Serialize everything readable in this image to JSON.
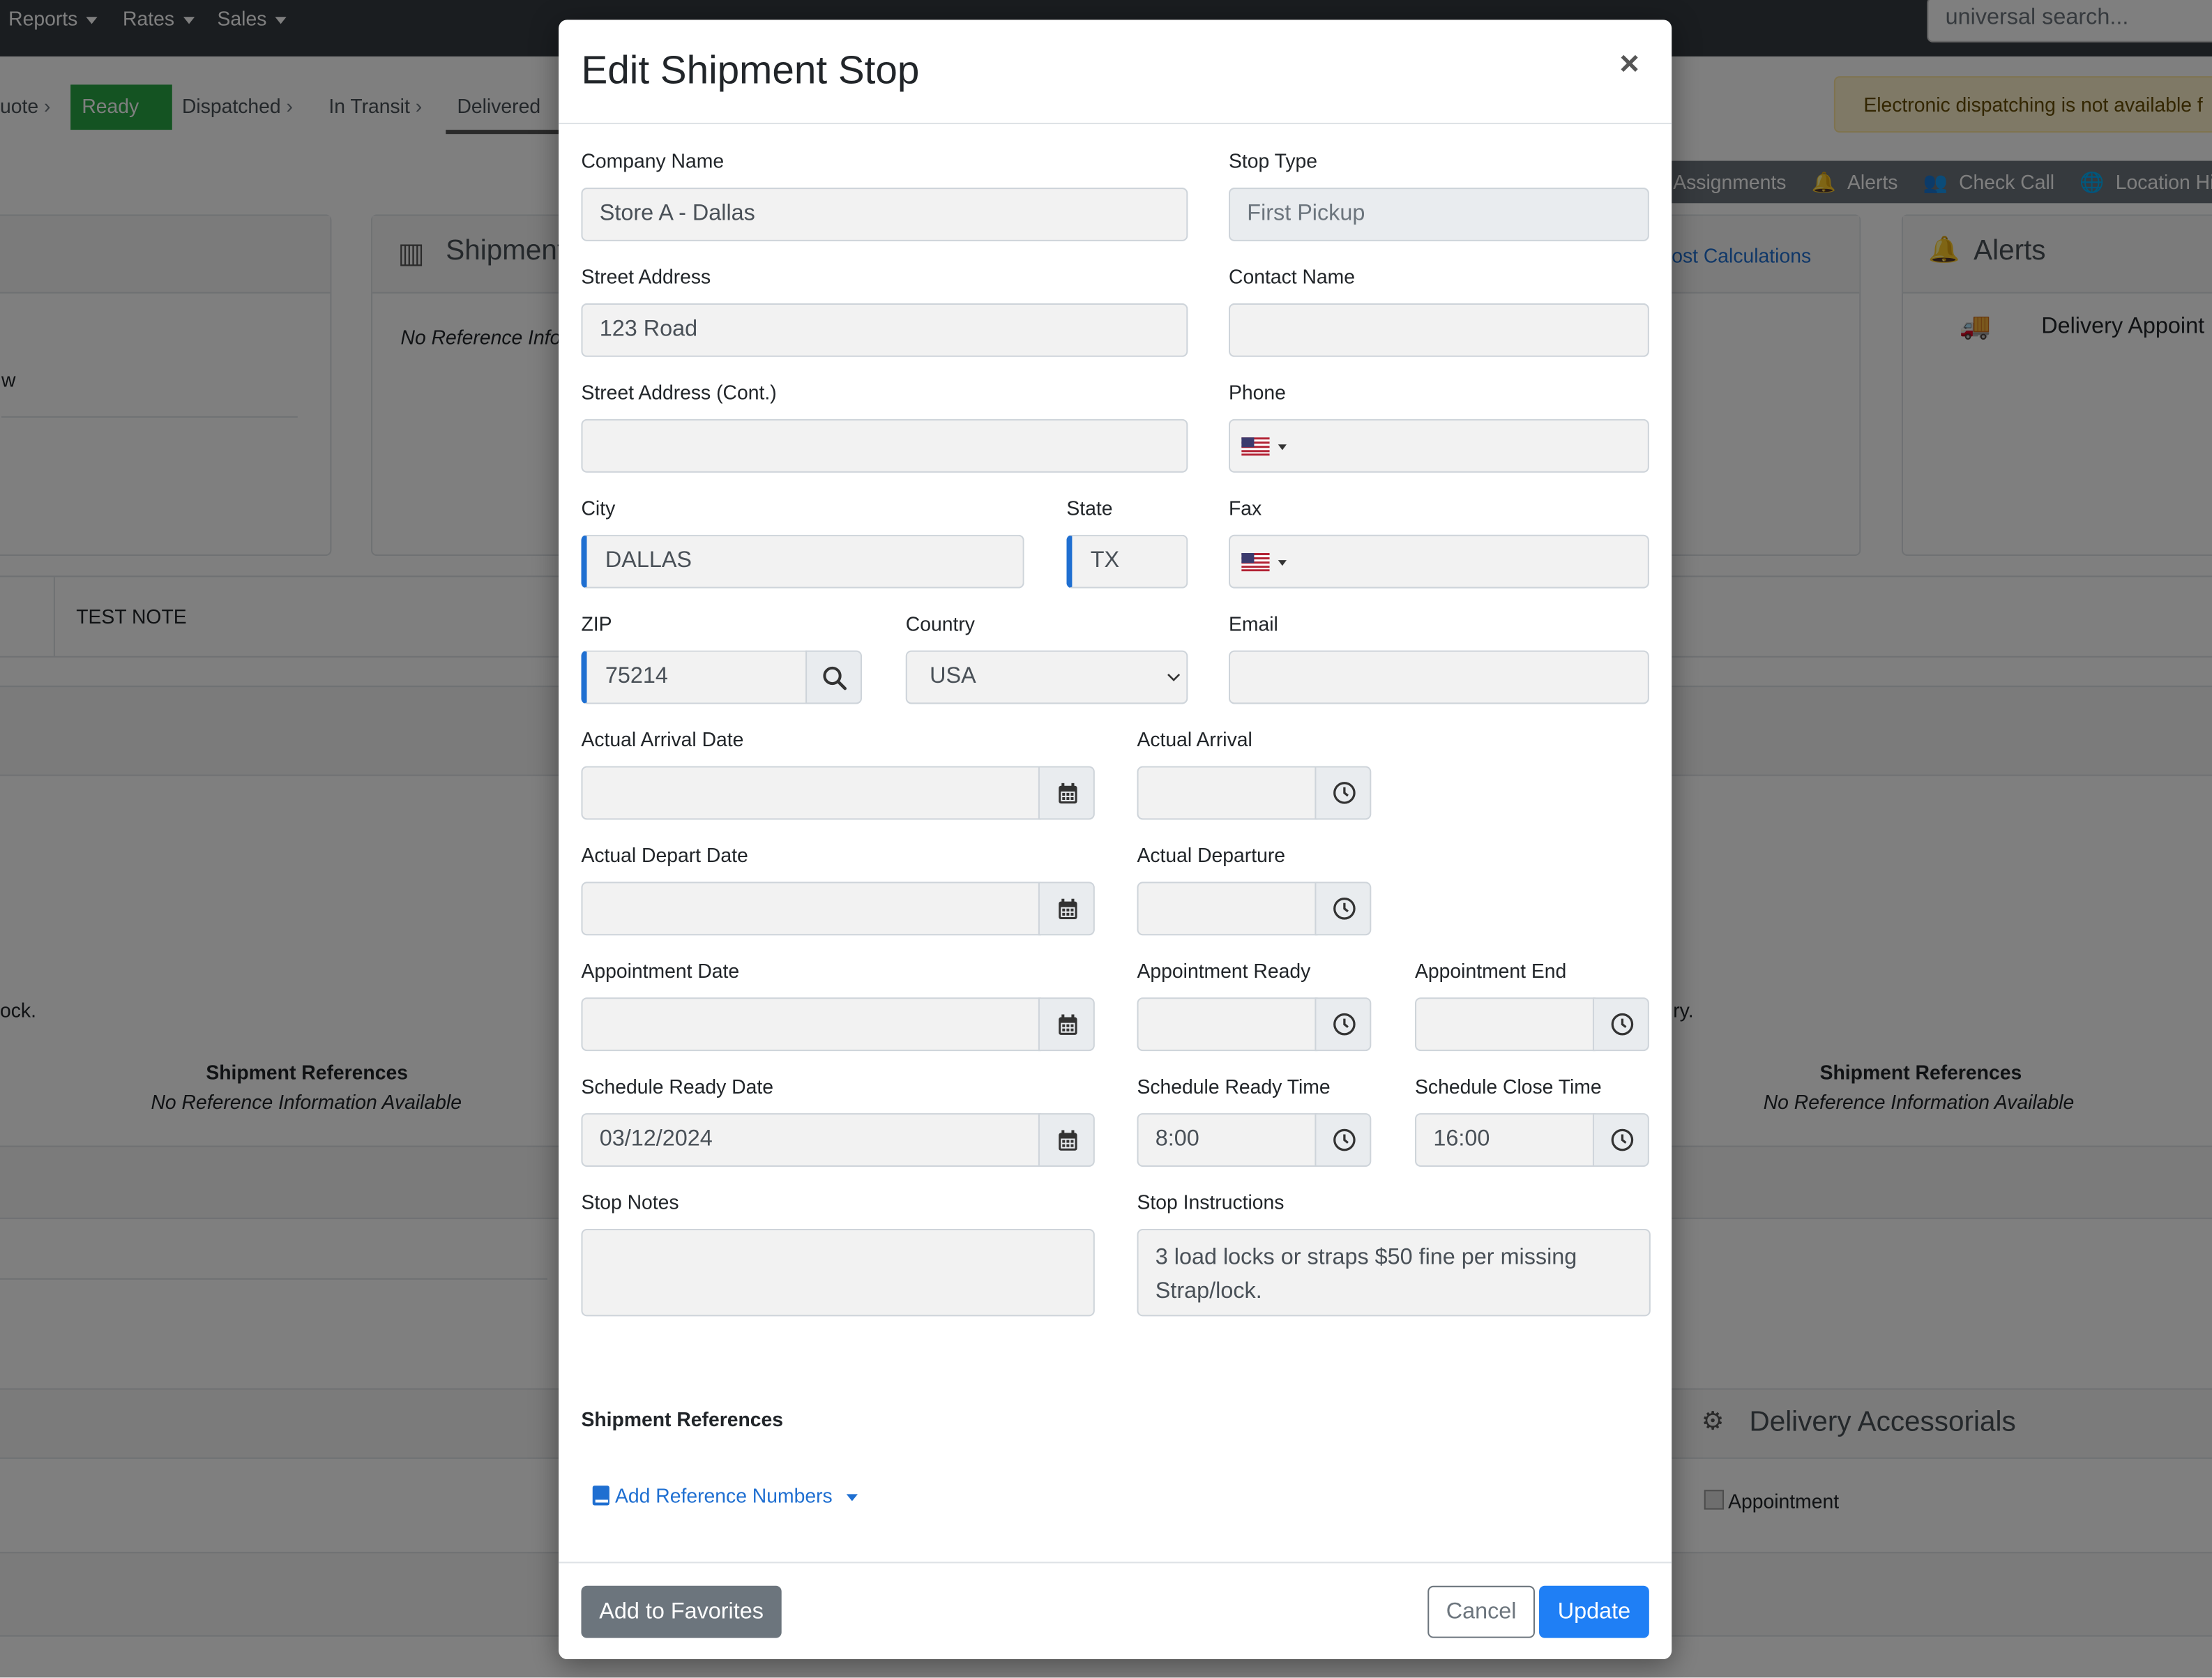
{
  "background": {
    "topnav": [
      "Reports",
      "Rates",
      "Sales"
    ],
    "search_placeholder": "universal search...",
    "status_steps": [
      "uote",
      "Ready",
      "Dispatched",
      "In Transit",
      "Delivered"
    ],
    "warning": "Electronic dispatching is not available f",
    "tabs": [
      "Assignments",
      "Alerts",
      "Check Call",
      "Location Histo"
    ],
    "shipment_card_title": "Shipment",
    "shipment_card_text": "No Reference Info",
    "cost_link": "ost Calculations",
    "alerts_title": "Alerts",
    "alerts_item": "Delivery Appoint",
    "left_fragment_w": "w",
    "note": "TEST NOTE",
    "left_fragment_lock": "ock.",
    "right_fragment_ry": "ry.",
    "ref_title_left": "Shipment References",
    "ref_text_left": "No Reference Information Available",
    "ref_title_right": "Shipment References",
    "ref_text_right": "No Reference Information Available",
    "delivery_accessorials": "Delivery Accessorials",
    "appointment_checkbox": "Appointment"
  },
  "modal": {
    "title": "Edit Shipment Stop",
    "close": "×",
    "labels": {
      "company_name": "Company Name",
      "stop_type": "Stop Type",
      "street_address": "Street Address",
      "contact_name": "Contact Name",
      "street_address_cont": "Street Address (Cont.)",
      "phone": "Phone",
      "city": "City",
      "state": "State",
      "fax": "Fax",
      "zip": "ZIP",
      "country": "Country",
      "email": "Email",
      "actual_arrival_date": "Actual Arrival Date",
      "actual_arrival": "Actual Arrival",
      "actual_depart_date": "Actual Depart Date",
      "actual_departure": "Actual Departure",
      "appointment_date": "Appointment Date",
      "appointment_ready": "Appointment Ready",
      "appointment_end": "Appointment End",
      "schedule_ready_date": "Schedule Ready Date",
      "schedule_ready_time": "Schedule Ready Time",
      "schedule_close_time": "Schedule Close Time",
      "stop_notes": "Stop Notes",
      "stop_instructions": "Stop Instructions"
    },
    "values": {
      "company_name": "Store A - Dallas",
      "stop_type": "First Pickup",
      "street_address": "123 Road",
      "contact_name": "",
      "street_address_cont": "",
      "city": "DALLAS",
      "state": "TX",
      "zip": "75214",
      "country": "USA",
      "email": "",
      "actual_arrival_date": "",
      "actual_arrival": "",
      "actual_depart_date": "",
      "actual_departure": "",
      "appointment_date": "",
      "appointment_ready": "",
      "appointment_end": "",
      "schedule_ready_date": "03/12/2024",
      "schedule_ready_time": "8:00",
      "schedule_close_time": "16:00",
      "stop_notes": "",
      "stop_instructions": "3 load locks or straps $50 fine per missing Strap/lock."
    },
    "shipment_references_heading": "Shipment References",
    "add_reference_numbers": "Add Reference Numbers",
    "buttons": {
      "add_to_favorites": "Add to Favorites",
      "cancel": "Cancel",
      "update": "Update"
    }
  },
  "colors": {
    "primary": "#1f6fd1",
    "success": "#28a745",
    "secondary": "#6c757d"
  }
}
